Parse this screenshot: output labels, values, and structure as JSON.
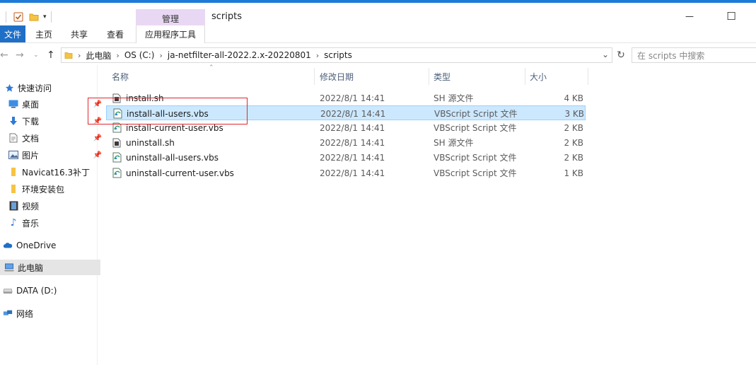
{
  "window": {
    "title": "scripts",
    "context_tab": "管理",
    "minimize_glyph": "—",
    "maximize_glyph": "☐"
  },
  "ribbon": {
    "tabs": [
      {
        "label": "文件"
      },
      {
        "label": "主页"
      },
      {
        "label": "共享"
      },
      {
        "label": "查看"
      },
      {
        "label": "应用程序工具"
      }
    ]
  },
  "address": {
    "crumbs": [
      "此电脑",
      "OS (C:)",
      "ja-netfilter-all-2022.2.x-20220801",
      "scripts"
    ],
    "search_placeholder": "在 scripts 中搜索"
  },
  "sidebar": {
    "items": [
      {
        "label": "快速访问",
        "icon": "star-icon",
        "pinned": false
      },
      {
        "label": "桌面",
        "icon": "desktop-icon",
        "pinned": true
      },
      {
        "label": "下载",
        "icon": "download-icon",
        "pinned": true
      },
      {
        "label": "文档",
        "icon": "document-icon",
        "pinned": true
      },
      {
        "label": "图片",
        "icon": "pictures-icon",
        "pinned": true
      },
      {
        "label": "Navicat16.3补丁",
        "icon": "folder-icon",
        "pinned": false
      },
      {
        "label": "环境安装包",
        "icon": "folder-icon",
        "pinned": false
      },
      {
        "label": "视频",
        "icon": "video-icon",
        "pinned": false
      },
      {
        "label": "音乐",
        "icon": "music-icon",
        "pinned": false
      },
      {
        "label": "OneDrive",
        "icon": "cloud-icon",
        "pinned": false
      },
      {
        "label": "此电脑",
        "icon": "computer-icon",
        "pinned": false,
        "selected": true
      },
      {
        "label": "DATA (D:)",
        "icon": "drive-icon",
        "pinned": false
      },
      {
        "label": "网络",
        "icon": "network-icon",
        "pinned": false
      }
    ]
  },
  "columns": [
    "名称",
    "修改日期",
    "类型",
    "大小"
  ],
  "files": [
    {
      "name": "install.sh",
      "date": "2022/8/1 14:41",
      "type": "SH 源文件",
      "size": "4 KB",
      "icon": "sh-file-icon"
    },
    {
      "name": "install-all-users.vbs",
      "date": "2022/8/1 14:41",
      "type": "VBScript Script 文件",
      "size": "3 KB",
      "icon": "vbs-file-icon",
      "selected": true
    },
    {
      "name": "install-current-user.vbs",
      "date": "2022/8/1 14:41",
      "type": "VBScript Script 文件",
      "size": "2 KB",
      "icon": "vbs-file-icon"
    },
    {
      "name": "uninstall.sh",
      "date": "2022/8/1 14:41",
      "type": "SH 源文件",
      "size": "2 KB",
      "icon": "sh-file-icon"
    },
    {
      "name": "uninstall-all-users.vbs",
      "date": "2022/8/1 14:41",
      "type": "VBScript Script 文件",
      "size": "2 KB",
      "icon": "vbs-file-icon"
    },
    {
      "name": "uninstall-current-user.vbs",
      "date": "2022/8/1 14:41",
      "type": "VBScript Script 文件",
      "size": "1 KB",
      "icon": "vbs-file-icon"
    }
  ],
  "colors": {
    "accent": "#1f6fc7",
    "context_tab_bg": "#e9d8f4",
    "selection_bg": "#cce8ff",
    "annotation": "#e0262f"
  }
}
